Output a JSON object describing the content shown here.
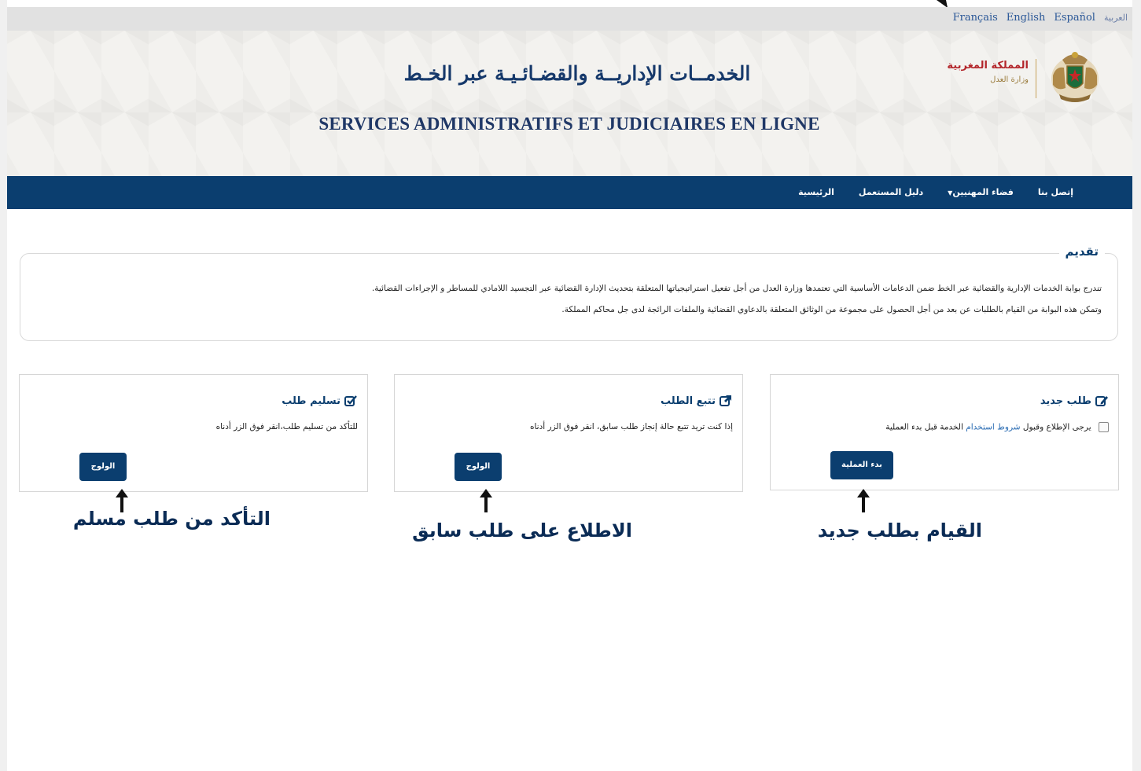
{
  "languages": [
    "Français",
    "English",
    "Español",
    "العربية"
  ],
  "header": {
    "title_ar": "الخدمــات الإداريــة والقضـائـيـة عبر الخـط",
    "title_fr": "SERVICES ADMINISTRATIFS ET JUDICIAIRES EN LIGNE",
    "logo_kingdom": "المملكة المغربية",
    "logo_ministry": "وزارة العدل"
  },
  "nav": {
    "items": [
      "الرئيسية",
      "دليل المستعمل",
      "فضاء المهنيين",
      "إتصل بنا"
    ]
  },
  "intro": {
    "legend": "تقديم",
    "p1": "تندرج بوابة الخدمات الإدارية والقضائية عبر الخط ضمن الدعامات الأساسية التي تعتمدها وزارة العدل من أجل تفعيل استراتيجياتها المتعلقة بتحديث الإدارة القضائية عبر التجسيد اللامادي للمساطر و الإجراءات القضائية.",
    "p2": "وتمكن هذه البوابة من القيام بالطلبات عن بعد من أجل الحصول على مجموعة من الوثائق المتعلقة بالدعاوي القضائية والملفات الرائجة لدى جل محاكم المملكة."
  },
  "boxes": {
    "new": {
      "title": "طلب جديد",
      "desc_before": "يرجى الإطلاع وقبول",
      "desc_link": "شروط استخدام",
      "desc_after": "الخدمة قبل بدء العملية",
      "button": "بدء العملية"
    },
    "track": {
      "title": "تتبع الطلب",
      "desc": "إذا كنت تريد تتبع حالة إنجاز طلب سابق، انقر فوق الزر أدناه",
      "button": "الولوج"
    },
    "deliver": {
      "title": "تسليم طلب",
      "desc": "للتأكد من تسليم طلب،انقر فوق الزر أدناه",
      "button": "الولوج"
    }
  },
  "captions": {
    "new": "القيام بطلب جديد",
    "track": "الاطلاع على طلب سابق",
    "deliver": "التأكد من طلب مسلم"
  },
  "colors": {
    "navy": "#0b3e6f",
    "link": "#2a5797",
    "kingdom_red": "#b3262b"
  }
}
